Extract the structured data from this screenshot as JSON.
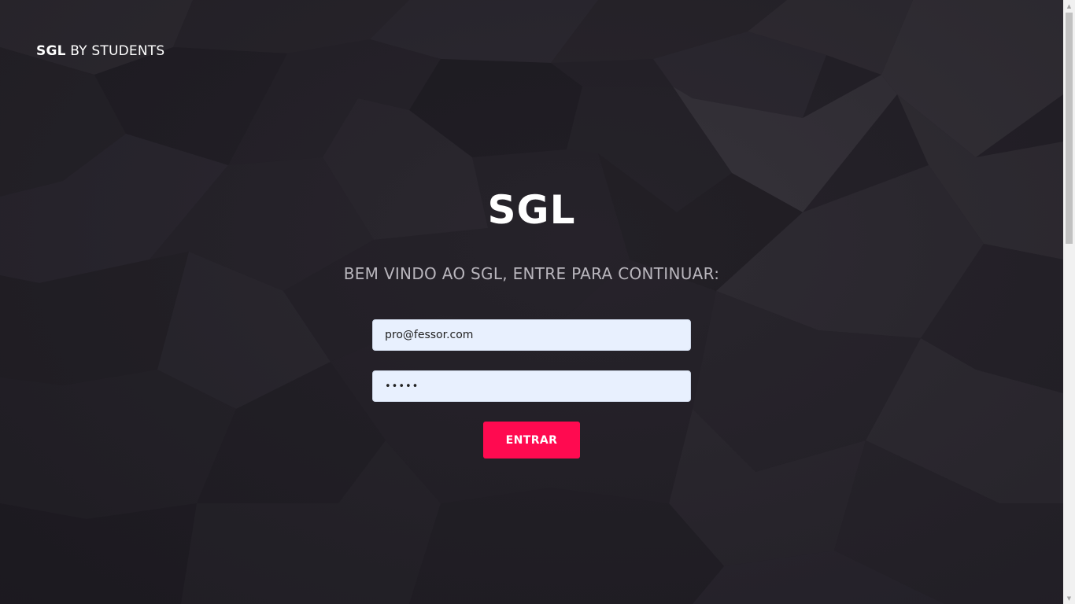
{
  "brand": {
    "name_bold": "SGL",
    "name_light": " BY STUDENTS"
  },
  "login": {
    "title": "SGL",
    "subtitle": "BEM VINDO AO SGL, ENTRE PARA CONTINUAR:",
    "email_value": "pro@fessor.com",
    "password_value": "•••••",
    "submit_label": "ENTRAR"
  },
  "colors": {
    "background": "#28252d",
    "accent": "#ff0a50",
    "input_bg": "#e8f0fe"
  },
  "icons": {
    "scroll_up": "scroll-up-arrow-icon",
    "scroll_down": "scroll-down-arrow-icon"
  }
}
